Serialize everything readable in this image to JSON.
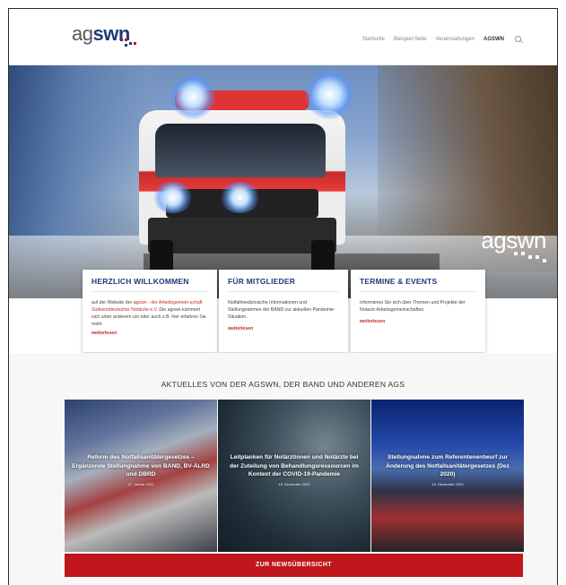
{
  "header": {
    "logo_prefix": "ag",
    "logo_suffix": "swn",
    "nav": [
      {
        "label": "Startseite",
        "active": false
      },
      {
        "label": "Beispiel-Seite",
        "active": false
      },
      {
        "label": "Veranstaltungen",
        "active": false
      },
      {
        "label": "AGSWN",
        "active": true
      }
    ]
  },
  "hero": {
    "logo_text": "agswn"
  },
  "cards": [
    {
      "title": "HERZLICH WILLKOMMEN",
      "text_before": "auf der Website der ",
      "text_link": "agswn - der Arbeitsgemein-schaft Südwestdeutscher Notärzte e.V.",
      "text_after": " Die agswn kümmert sich unter anderem um oder auch z.B. hier erfahren Sie mehr",
      "more": "weiterlesen"
    },
    {
      "title": "FÜR MITGLIEDER",
      "text": "Notfallmedizinische Informationen und Stellungnahmen der BAND zur aktuellen Pandemie-Situation.",
      "more": "weiterlesen"
    },
    {
      "title": "TERMINE & EVENTS",
      "text": "Informieren Sie sich über Themen und Projekte der Notarzt-Arbeitsgemeinschaften.",
      "more": "weiterlesen"
    }
  ],
  "news": {
    "title": "AKTUELLES VON DER AGSWN, DER BAND UND ANDEREN AGS",
    "items": [
      {
        "title": "Reform des Notfallsanitätergesetzes – Ergänzende Stellungnahme von BAND, BV-ÄLRD und DBRD",
        "date": "27. Januar 2021"
      },
      {
        "title": "Leitplanken für Notärztinnen und Notärzte bei der Zuteilung von Behandlungsressourcen im Kontext der COVID-19-Pandemie",
        "date": "19. Dezember 2020"
      },
      {
        "title": "Stellungnahme zum Referentenentwurf zur Änderung des Notfallsanitätergesetzes (Dez 2020)",
        "date": "14. Dezember 2020"
      }
    ],
    "button_label": "ZUR NEWSÜBERSICHT"
  },
  "colors": {
    "brand_blue": "#1f3a78",
    "brand_red": "#c0161c"
  },
  "icons": [
    "search-icon"
  ]
}
